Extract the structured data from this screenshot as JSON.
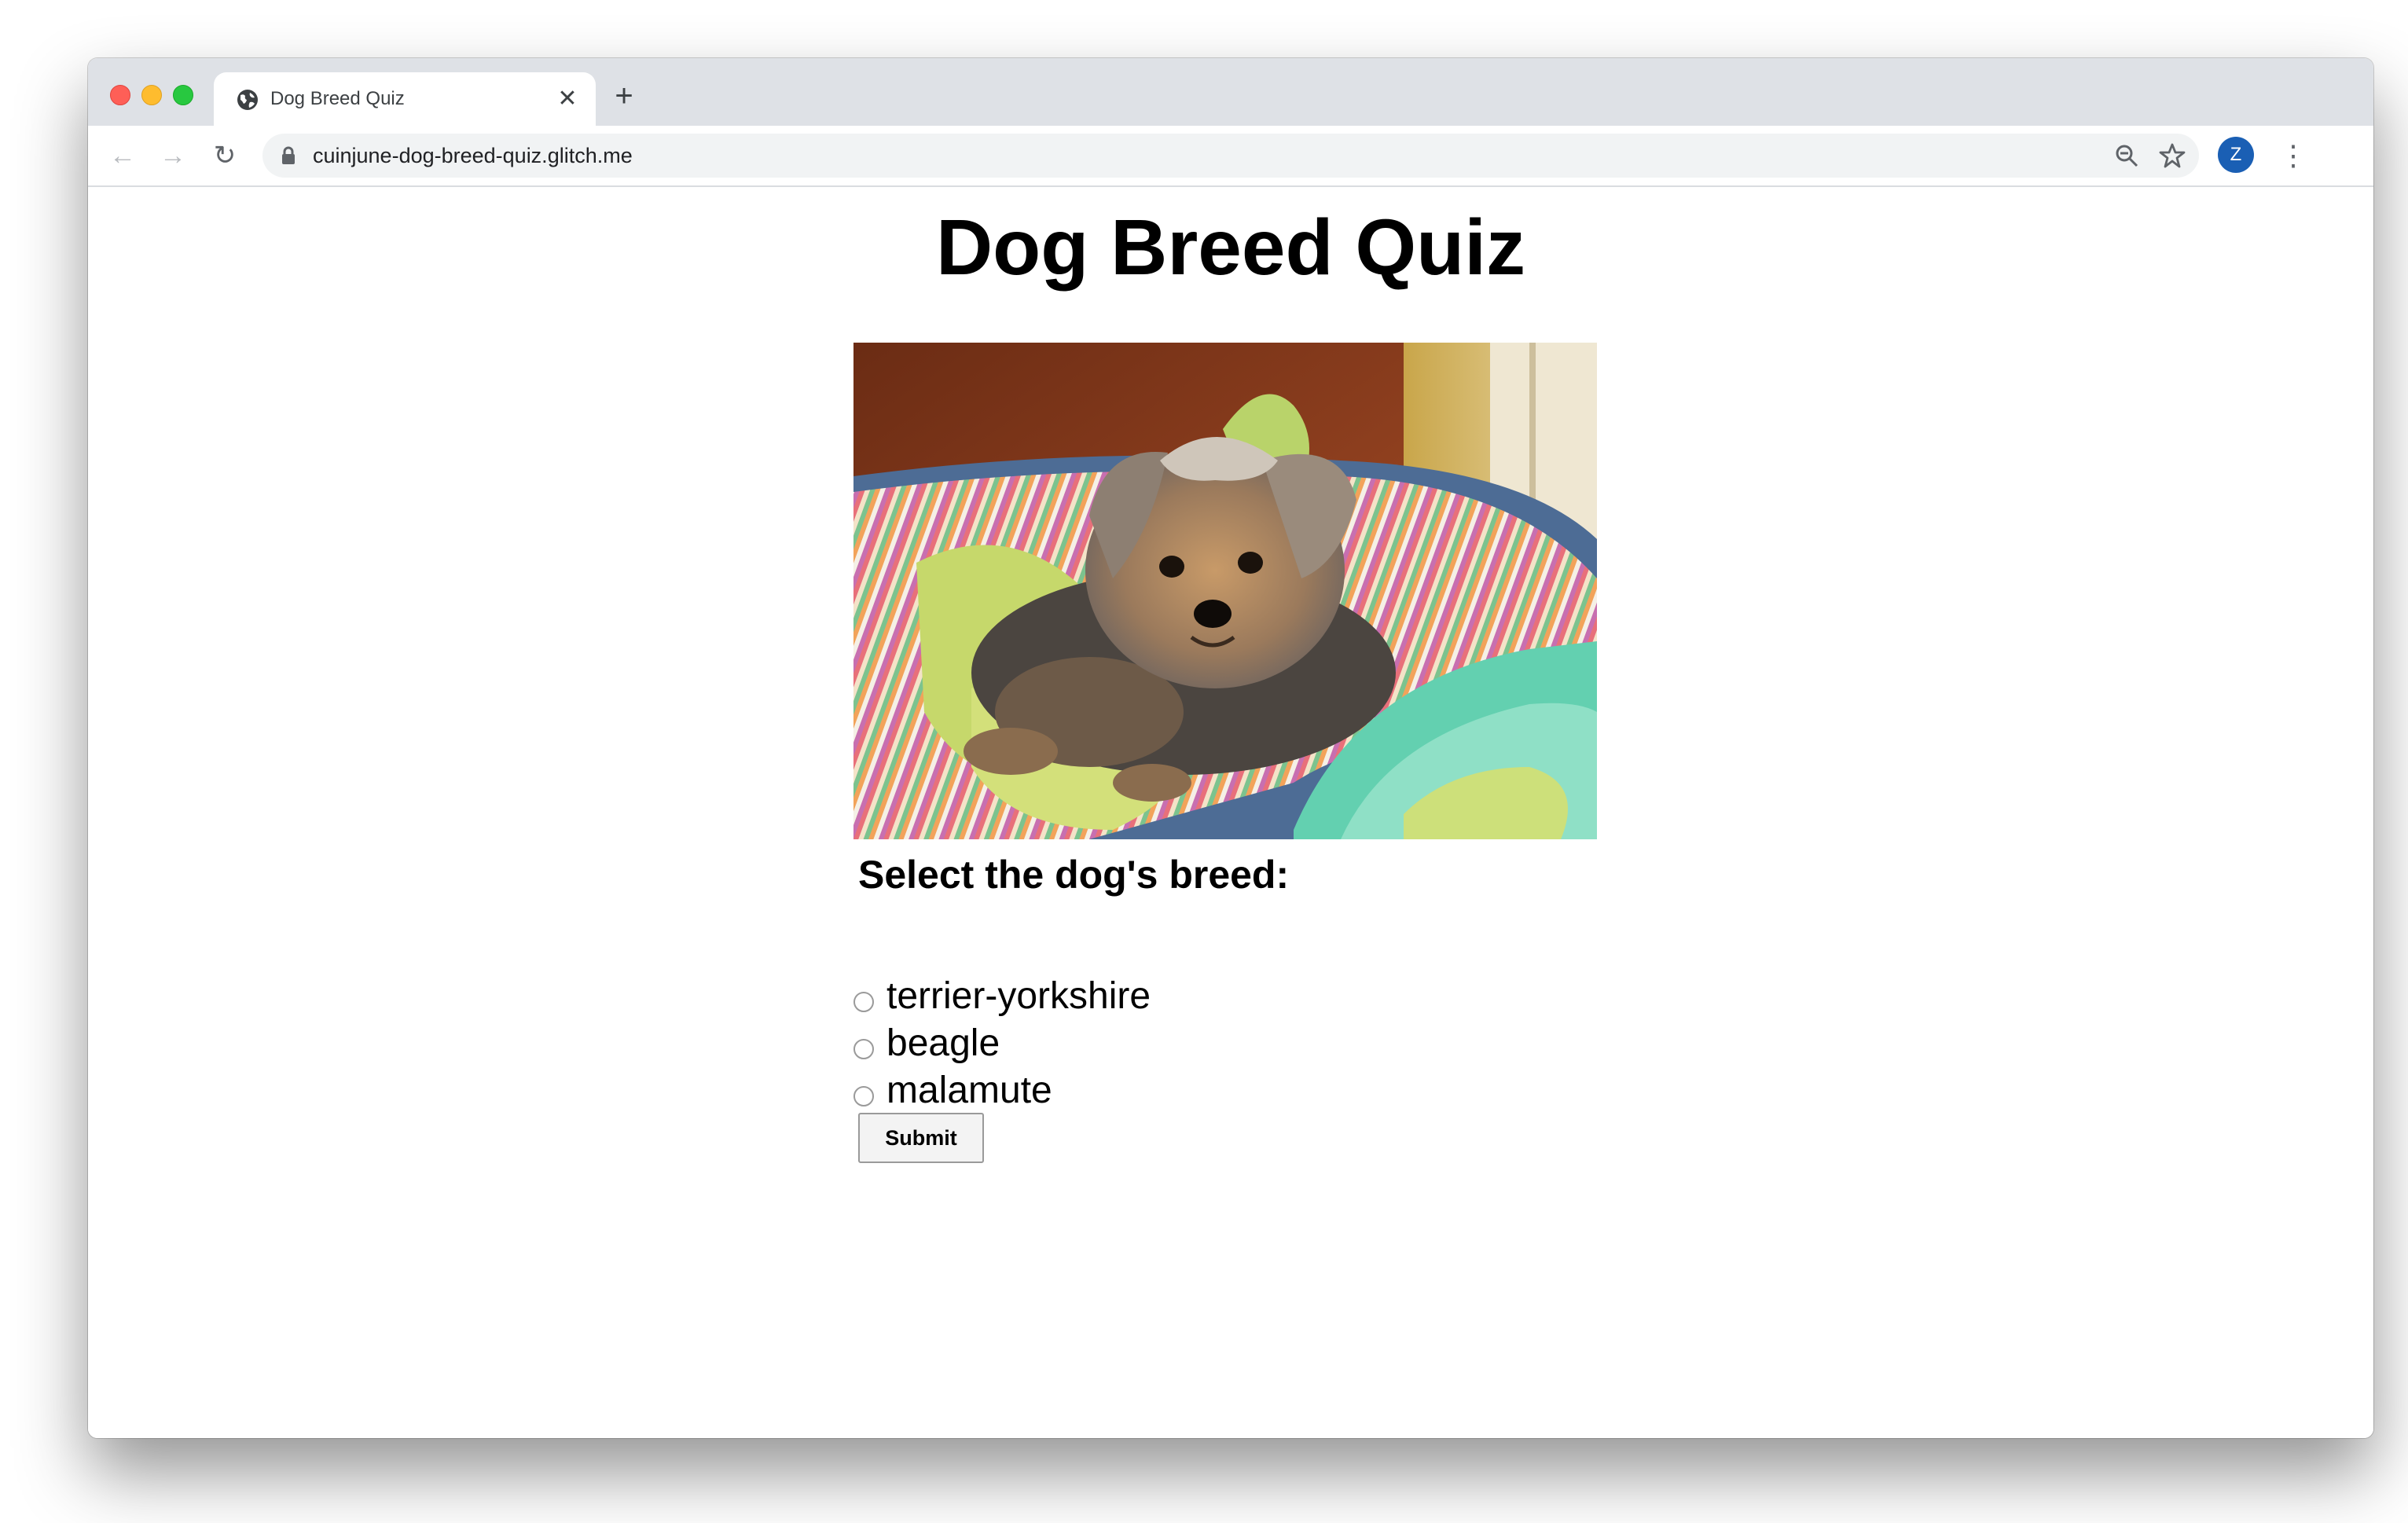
{
  "browser": {
    "tab": {
      "title": "Dog Breed Quiz",
      "close_glyph": "✕"
    },
    "new_tab_glyph": "+",
    "nav": {
      "back": "←",
      "forward": "→",
      "reload": "↻"
    },
    "address_bar": {
      "url": "cuinjune-dog-breed-quiz.glitch.me"
    },
    "profile": {
      "initial": "Z",
      "color": "#1a5fb4"
    },
    "menu_glyph": "⋮",
    "icons": [
      "globe-icon",
      "lock-icon",
      "zoom-icon",
      "star-icon"
    ]
  },
  "page": {
    "title": "Dog Breed Quiz",
    "image": {
      "subject": "Yorkshire terrier lying in a striped dog bed"
    },
    "question": "Select the dog's breed:",
    "options": [
      "terrier-yorkshire",
      "beagle",
      "malamute"
    ],
    "submit_label": "Submit"
  }
}
